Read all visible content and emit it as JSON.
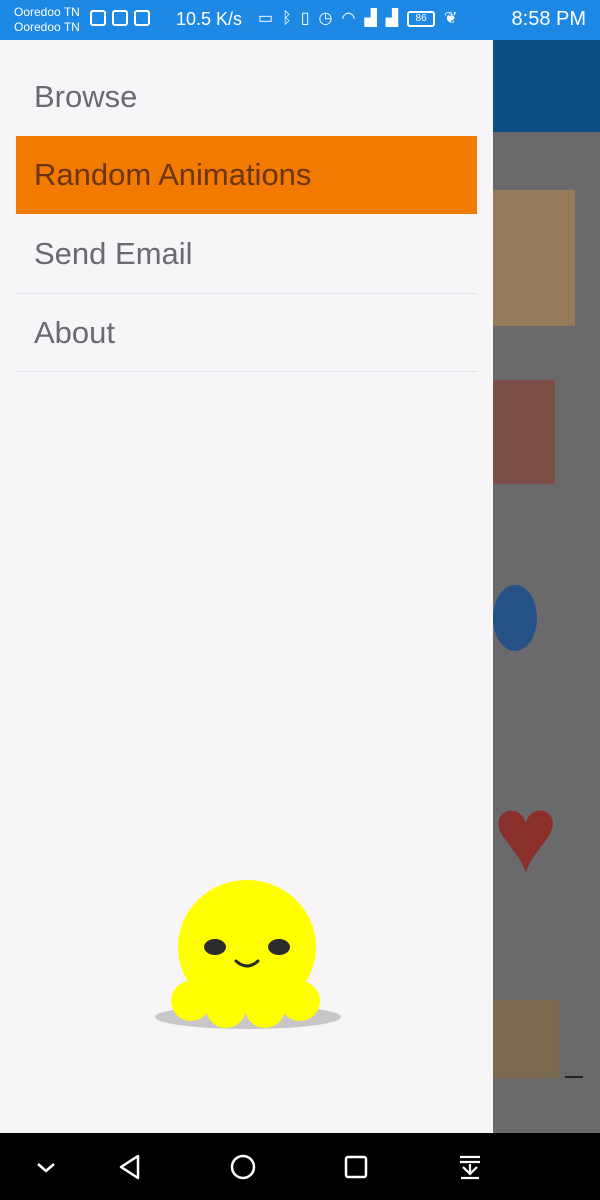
{
  "status_bar": {
    "carrier_1": "Ooredoo TN",
    "carrier_2": "Ooredoo TN",
    "network_speed": "10.5 K/s",
    "battery_level": "86",
    "time": "8:58 PM",
    "color": "#1e88e5",
    "icons": [
      "camera-icon",
      "photo-icon",
      "message-icon",
      "cast-icon",
      "bluetooth-icon",
      "vibrate-icon",
      "alarm-icon",
      "wifi-icon",
      "signal-3g-icon",
      "signal-2g-icon",
      "battery-icon",
      "leaf-icon"
    ]
  },
  "drawer": {
    "items": [
      {
        "label": "Browse",
        "active": false
      },
      {
        "label": "Random Animations",
        "active": true
      },
      {
        "label": "Send Email",
        "active": false
      },
      {
        "label": "About",
        "active": false
      }
    ],
    "active_color": "#f37a00",
    "mascot": "yellow-octopus-illustration"
  },
  "navigation_bar": {
    "buttons": [
      "chevron-down-icon",
      "back-icon",
      "home-icon",
      "recents-icon",
      "notification-pull-icon"
    ]
  }
}
